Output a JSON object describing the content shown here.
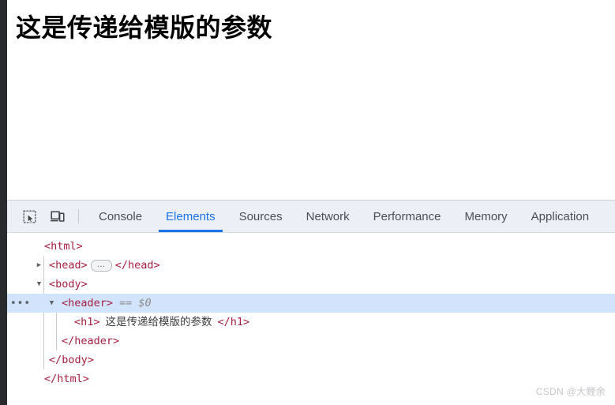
{
  "page": {
    "heading": "这是传递给模版的参数"
  },
  "devtools": {
    "toolbar": {
      "inspect_icon": "inspect-element-icon",
      "device_icon": "device-toolbar-icon"
    },
    "tabs": [
      {
        "label": "Console",
        "active": false
      },
      {
        "label": "Elements",
        "active": true
      },
      {
        "label": "Sources",
        "active": false
      },
      {
        "label": "Network",
        "active": false
      },
      {
        "label": "Performance",
        "active": false
      },
      {
        "label": "Memory",
        "active": false
      },
      {
        "label": "Application",
        "active": false
      }
    ],
    "accent_color": "#1a73e8",
    "selected_row_color": "#d2e3fc",
    "tag_color": "#881280",
    "punct_color": "#a52040",
    "dom_tree": [
      {
        "tag_open": "<html>"
      },
      {
        "tag_open": "<head>",
        "collapsed_badge": "…",
        "tag_close": "</head>"
      },
      {
        "tag_open": "<body>"
      },
      {
        "tag_open": "<header>",
        "annotation": "== $0",
        "gutter_badge": "•••"
      },
      {
        "tag_open": "<h1>",
        "text": "这是传递给模版的参数",
        "tag_close": "</h1>"
      },
      {
        "tag_close": "</header>"
      },
      {
        "tag_close": "</body>"
      },
      {
        "tag_close": "</html>"
      }
    ]
  },
  "watermark": "CSDN @大鲤余"
}
